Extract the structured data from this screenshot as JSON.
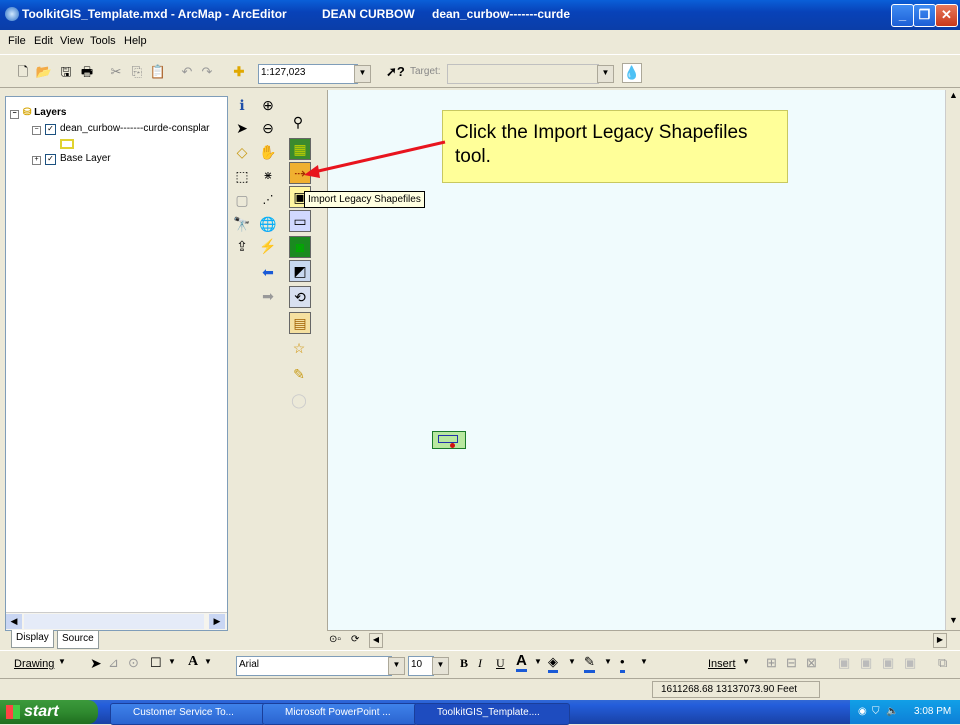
{
  "window": {
    "title": "ToolkitGIS_Template.mxd - ArcMap - ArcEditor",
    "user": "DEAN CURBOW",
    "layer_context": "dean_curbow-------curde"
  },
  "menu": [
    "File",
    "Edit",
    "View",
    "Tools",
    "Help"
  ],
  "toolbar": {
    "scale": "1:127,023",
    "target_label": "Target:"
  },
  "toc": {
    "root": "Layers",
    "items": [
      {
        "label": "dean_curbow-------curde-consplar",
        "checked": true
      },
      {
        "label": "Base Layer",
        "checked": true
      }
    ],
    "tabs": [
      "Display",
      "Source"
    ]
  },
  "callout": "Click the Import Legacy Shapefiles tool.",
  "tooltip": "Import Legacy Shapefiles",
  "drawing": {
    "drawing_label": "Drawing",
    "font": "Arial",
    "font_size": "10",
    "insert_label": "Insert",
    "bold": "B",
    "italic": "I",
    "underline": "U",
    "text_tool": "A"
  },
  "status": {
    "coordinates": "1611268.68  13137073.90 Feet"
  },
  "taskbar": {
    "start": "start",
    "tasks": [
      "Customer Service To...",
      "Microsoft PowerPoint ...",
      "ToolkitGIS_Template...."
    ],
    "clock": "3:08 PM"
  },
  "colors": {
    "callout_bg": "#ffff99",
    "arrow": "#e8141e",
    "map_bg": "#f0fbfd",
    "titlebar": "#0a5fd8"
  }
}
